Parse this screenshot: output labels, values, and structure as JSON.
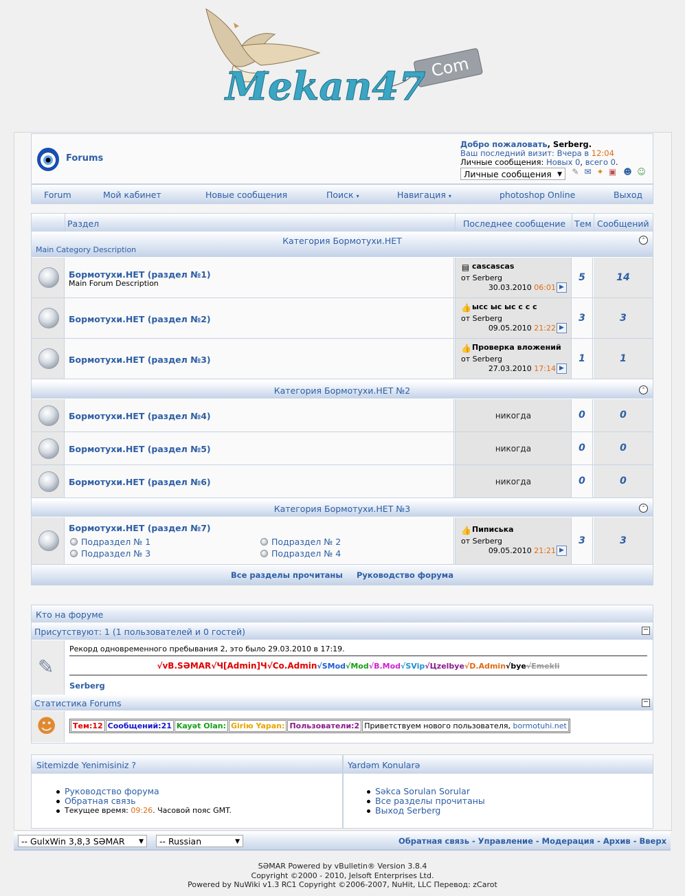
{
  "site": {
    "logo_text": "Mekan47",
    "logo_tag": "Com"
  },
  "header": {
    "forum_title": "Forums",
    "welcome_prefix": "Добро пожаловать",
    "welcome_user": "Serberg",
    "last_visit_label": "Ваш последний визит:",
    "last_visit_day": "Вчера в",
    "last_visit_time": "12:04",
    "pm_label": "Личные сообщения:",
    "pm_new": "Новых 0",
    "pm_total": "всего 0",
    "pm_select": "Личные сообщения"
  },
  "nav": [
    "Forum",
    "Мой кабинет",
    "Новые сообщения",
    "Поиск",
    "Навигация",
    "photoshop Online",
    "Выход"
  ],
  "columns": {
    "section": "Раздел",
    "last": "Последнее сообщение",
    "threads": "Тем",
    "posts": "Сообщений"
  },
  "categories": [
    {
      "title": "Категория Бормотухи.НЕТ",
      "description": "Main Category Description",
      "forums": [
        {
          "title": "Бормотухи.НЕТ (раздел №1)",
          "description": "Main Forum Description",
          "last_title": "cascascas",
          "last_icon": "doc",
          "last_by": "от Serberg",
          "last_date": "30.03.2010",
          "last_time": "06:01",
          "threads": "5",
          "posts": "14"
        },
        {
          "title": "Бормотухи.НЕТ (раздел №2)",
          "description": "",
          "last_title": "ысс ыс ыс с с с",
          "last_icon": "thumb",
          "last_by": "от Serberg",
          "last_date": "09.05.2010",
          "last_time": "21:22",
          "threads": "3",
          "posts": "3"
        },
        {
          "title": "Бормотухи.НЕТ (раздел №3)",
          "description": "",
          "last_title": "Проверка вложений",
          "last_icon": "thumb",
          "last_by": "от Serberg",
          "last_date": "27.03.2010",
          "last_time": "17:14",
          "threads": "1",
          "posts": "1"
        }
      ]
    },
    {
      "title": "Категория Бормотухи.НЕТ №2",
      "description": "",
      "forums": [
        {
          "title": "Бормотухи.НЕТ (раздел №4)",
          "never": "никогда",
          "threads": "0",
          "posts": "0"
        },
        {
          "title": "Бормотухи.НЕТ (раздел №5)",
          "never": "никогда",
          "threads": "0",
          "posts": "0"
        },
        {
          "title": "Бормотухи.НЕТ (раздел №6)",
          "never": "никогда",
          "threads": "0",
          "posts": "0"
        }
      ]
    },
    {
      "title": "Категория Бормотухи.НЕТ №3",
      "description": "",
      "forums": [
        {
          "title": "Бормотухи.НЕТ (раздел №7)",
          "subforums": [
            "Подраздел № 1",
            "Подраздел № 2",
            "Подраздел № 3",
            "Подраздел № 4"
          ],
          "last_title": "Пиписька",
          "last_icon": "thumb",
          "last_by": "от Serberg",
          "last_date": "09.05.2010",
          "last_time": "21:21",
          "threads": "3",
          "posts": "3"
        }
      ]
    }
  ],
  "footer_links": {
    "mark_read": "Все разделы прочитаны",
    "guide": "Руководство форума"
  },
  "whos_online": {
    "title": "Кто на форуме",
    "present": "Присутствуют: 1 (1 пользователей и 0 гостей)",
    "record": "Рекорд одновременного пребывания 2, это было 29.03.2010 в 17:19.",
    "groups": [
      {
        "text": "√vB.SƏMAR",
        "color": "#e00000"
      },
      {
        "text": "√Ч[Admin]Ч",
        "color": "#e00000"
      },
      {
        "text": "√Co.Admin",
        "color": "#e00000"
      },
      {
        "text": "√SMod",
        "color": "#1e5fd0"
      },
      {
        "text": "√Mod",
        "color": "#17a017"
      },
      {
        "text": "√B.Mod",
        "color": "#d01fd0"
      },
      {
        "text": "√SVip",
        "color": "#1e90d0"
      },
      {
        "text": "√Цzelbye",
        "color": "#8a1a8a"
      },
      {
        "text": "√D.Admin",
        "color": "#e06b14"
      },
      {
        "text": "√bye",
        "color": "#000000"
      },
      {
        "text": "√Emekli",
        "color": "#9a9a9a"
      }
    ],
    "online_user": "Serberg"
  },
  "stats": {
    "title": "Статистика Forums",
    "items": [
      {
        "text": "Тем:12",
        "color": "#e00000"
      },
      {
        "text": "Сообщений:21",
        "color": "#1515d0"
      },
      {
        "text": "Kayət Olan:",
        "color": "#17a017"
      },
      {
        "text": "Giriю Yapan:",
        "color": "#e8a400"
      },
      {
        "text": "Пользователи:2",
        "color": "#8a1a8a"
      }
    ],
    "welcome": "Приветствуем нового пользователя,",
    "welcome_user": "bormotuhi.net"
  },
  "bottom_boxes": {
    "left_title": "Sitemizde Yenimisiniz ?",
    "left_items": [
      "Руководство форума",
      "Обратная связь"
    ],
    "time_prefix": "Текущее время:",
    "time_value": "09:26",
    "time_suffix": ". Часовой пояс GMT.",
    "right_title": "Yardəm Konularə",
    "right_items": [
      "Səkca Sorulan Sorular",
      "Все разделы прочитаны",
      "Выход Serberg"
    ]
  },
  "bottom_bar": {
    "style_select": "-- GulxWin 3,8,3 SƏMAR",
    "lang_select": "-- Russian",
    "links": [
      "Обратная связь",
      "Управление",
      "Модерация",
      "Архив",
      "Вверх"
    ]
  },
  "copyright": [
    "SƏMAR Powered by vBulletin® Version 3.8.4",
    "Copyright ©2000 - 2010, Jelsoft Enterprises Ltd.",
    "Powered by NuWiki v1.3 RC1 Copyright ©2006-2007, NuHit, LLC Перевод: zCarot"
  ]
}
